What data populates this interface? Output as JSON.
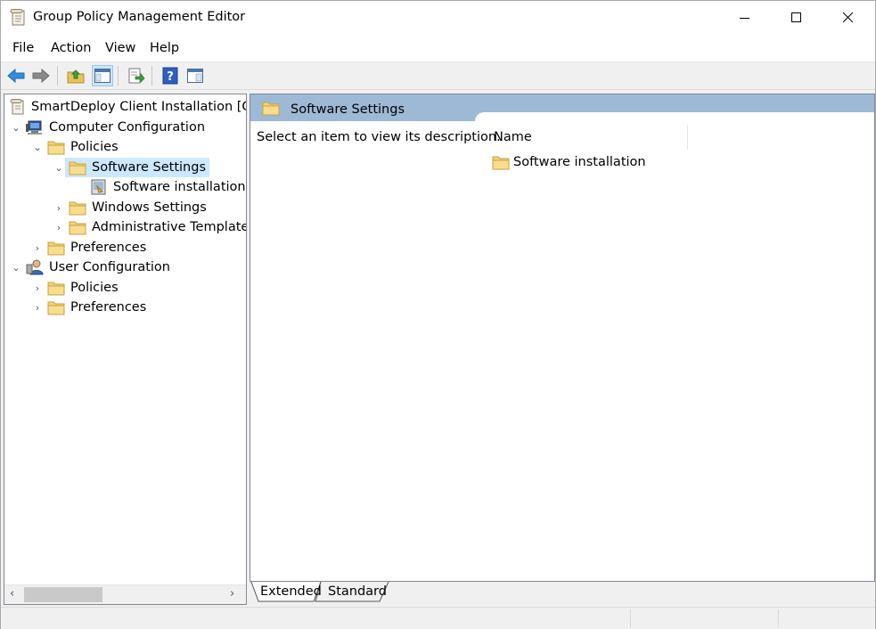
{
  "window": {
    "title": "Group Policy Management Editor",
    "app_icon": "gpo-editor-icon",
    "controls": [
      "minimize-icon",
      "maximize-icon",
      "close-icon"
    ]
  },
  "menu": [
    "File",
    "Action",
    "View",
    "Help"
  ],
  "toolbar": {
    "buttons": [
      "back-arrow-icon",
      "forward-arrow-icon",
      "up-folder-icon",
      "show-hide-tree-icon",
      "export-list-icon",
      "help-icon",
      "properties-pane-icon"
    ]
  },
  "tree": {
    "root": "SmartDeploy Client Installation [GPO",
    "computer_config": "Computer Configuration",
    "cc_policies": "Policies",
    "software_settings": "Software Settings",
    "software_installation": "Software installation",
    "windows_settings": "Windows Settings",
    "admin_templates": "Administrative Templates:",
    "cc_preferences": "Preferences",
    "user_config": "User Configuration",
    "uc_policies": "Policies",
    "uc_preferences": "Preferences"
  },
  "details": {
    "header": "Software Settings",
    "description": "Select an item to view its description.",
    "column_name": "Name",
    "items": [
      "Software installation"
    ]
  },
  "tabs": [
    "Extended",
    "Standard"
  ],
  "colors": {
    "header_blue": "#9db9d6",
    "selection": "#cce8ff",
    "folder_yellow": "#f3d27a"
  }
}
